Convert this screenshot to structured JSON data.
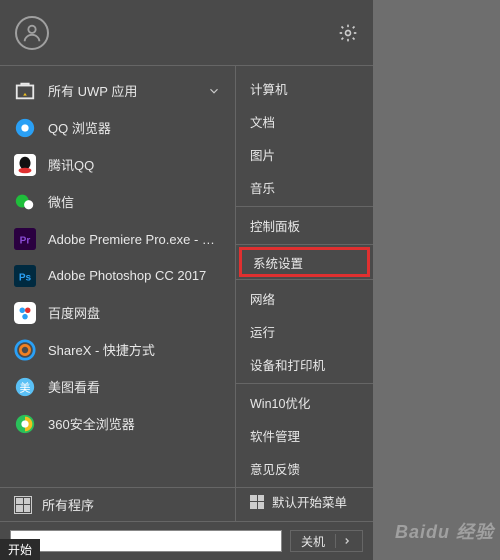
{
  "top": {
    "settings_icon": "settings-gear"
  },
  "left": {
    "header": {
      "label": "所有 UWP 应用",
      "icon": "uwp-store-icon",
      "badge": "star"
    },
    "apps": [
      {
        "label": "QQ 浏览器",
        "icon": "qq-browser",
        "color": "#2aa0f5"
      },
      {
        "label": "腾讯QQ",
        "icon": "qq",
        "color": "#e03030"
      },
      {
        "label": "微信",
        "icon": "wechat",
        "color": "#1fbe3b"
      },
      {
        "label": "Adobe Premiere Pro.exe - 快捷方式",
        "icon": "pr",
        "color": "#8a4bd6"
      },
      {
        "label": "Adobe Photoshop CC 2017",
        "icon": "ps",
        "color": "#2aa0f5"
      },
      {
        "label": "百度网盘",
        "icon": "baidu-pan",
        "color": "#2aa0f5"
      },
      {
        "label": "ShareX - 快捷方式",
        "icon": "sharex",
        "color": "#2aa0f5"
      },
      {
        "label": "美图看看",
        "icon": "meitu",
        "color": "#5ac0f5"
      },
      {
        "label": "360安全浏览器",
        "icon": "360",
        "color": "#2ac05a"
      }
    ]
  },
  "right": {
    "items": [
      {
        "label": "计算机",
        "sep": false
      },
      {
        "label": "文档",
        "sep": false
      },
      {
        "label": "图片",
        "sep": false
      },
      {
        "label": "音乐",
        "sep": true
      },
      {
        "label": "控制面板",
        "sep": true
      },
      {
        "label": "系统设置",
        "sep": true,
        "highlight": true
      },
      {
        "label": "网络",
        "sep": false
      },
      {
        "label": "运行",
        "sep": false
      },
      {
        "label": "设备和打印机",
        "sep": true
      },
      {
        "label": "Win10优化",
        "sep": false
      },
      {
        "label": "软件管理",
        "sep": false
      },
      {
        "label": "意见反馈",
        "sep": false
      }
    ],
    "default_menu": "默认开始菜单"
  },
  "bottom": {
    "all_programs": "所有程序",
    "search_placeholder": "",
    "power": "关机"
  },
  "start_tag": "开始",
  "watermark": "Baidu 经验"
}
